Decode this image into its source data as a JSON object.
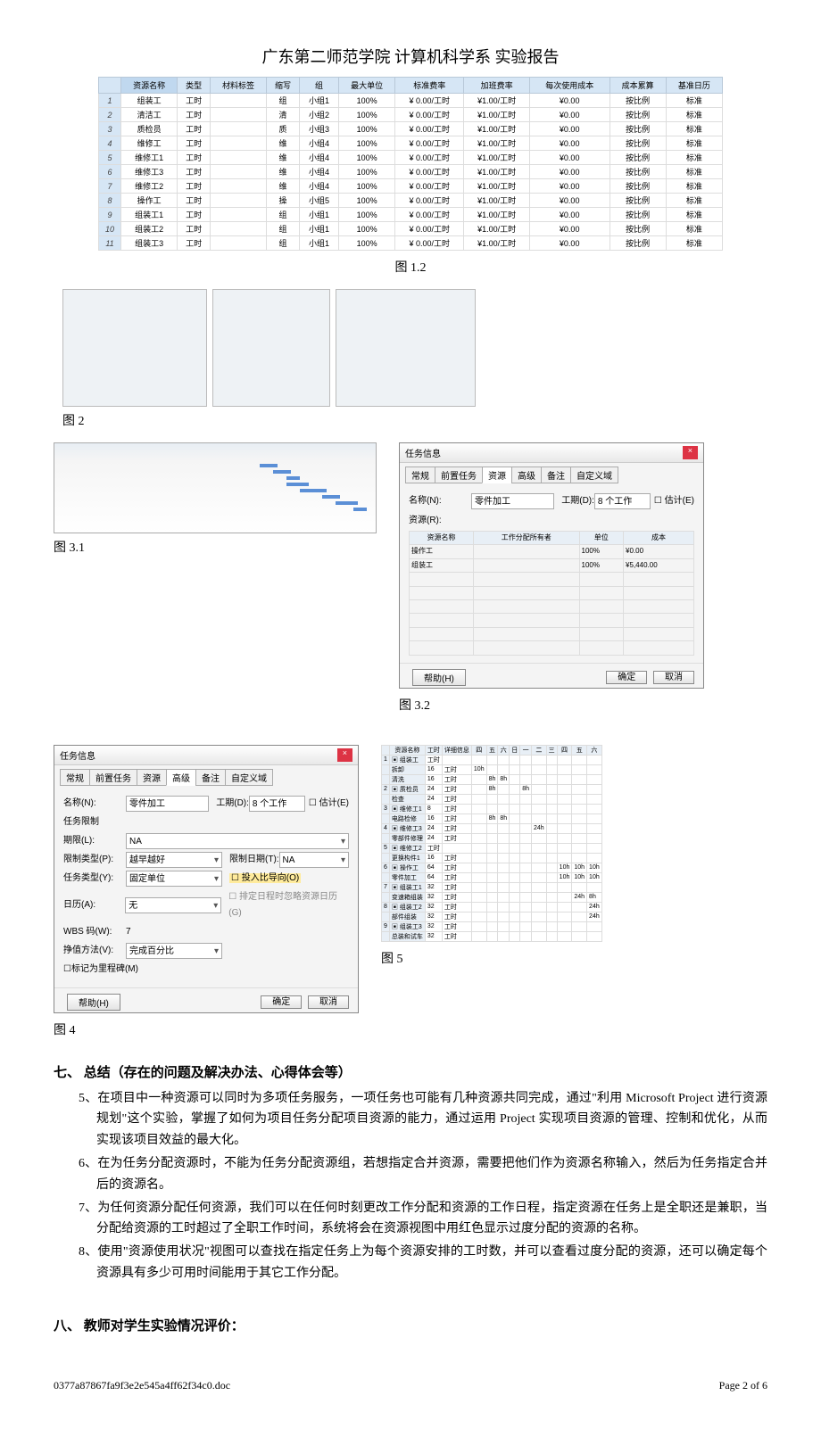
{
  "header": "广东第二师范学院 计算机科学系 实验报告",
  "table1": {
    "headers": [
      "",
      "资源名称",
      "类型",
      "材料标签",
      "缩写",
      "组",
      "最大单位",
      "标准费率",
      "加班费率",
      "每次使用成本",
      "成本累算",
      "基准日历"
    ],
    "rows": [
      [
        "1",
        "组装工",
        "工时",
        "",
        "组",
        "小组1",
        "100%",
        "¥ 0.00/工时",
        "¥1.00/工时",
        "¥0.00",
        "按比例",
        "标准"
      ],
      [
        "2",
        "清洁工",
        "工时",
        "",
        "清",
        "小组2",
        "100%",
        "¥ 0.00/工时",
        "¥1.00/工时",
        "¥0.00",
        "按比例",
        "标准"
      ],
      [
        "3",
        "质检员",
        "工时",
        "",
        "质",
        "小组3",
        "100%",
        "¥ 0.00/工时",
        "¥1.00/工时",
        "¥0.00",
        "按比例",
        "标准"
      ],
      [
        "4",
        "维修工",
        "工时",
        "",
        "维",
        "小组4",
        "100%",
        "¥ 0.00/工时",
        "¥1.00/工时",
        "¥0.00",
        "按比例",
        "标准"
      ],
      [
        "5",
        "维修工1",
        "工时",
        "",
        "维",
        "小组4",
        "100%",
        "¥ 0.00/工时",
        "¥1.00/工时",
        "¥0.00",
        "按比例",
        "标准"
      ],
      [
        "6",
        "维修工3",
        "工时",
        "",
        "维",
        "小组4",
        "100%",
        "¥ 0.00/工时",
        "¥1.00/工时",
        "¥0.00",
        "按比例",
        "标准"
      ],
      [
        "7",
        "维修工2",
        "工时",
        "",
        "维",
        "小组4",
        "100%",
        "¥ 0.00/工时",
        "¥1.00/工时",
        "¥0.00",
        "按比例",
        "标准"
      ],
      [
        "8",
        "操作工",
        "工时",
        "",
        "操",
        "小组5",
        "100%",
        "¥ 0.00/工时",
        "¥1.00/工时",
        "¥0.00",
        "按比例",
        "标准"
      ],
      [
        "9",
        "组装工1",
        "工时",
        "",
        "组",
        "小组1",
        "100%",
        "¥ 0.00/工时",
        "¥1.00/工时",
        "¥0.00",
        "按比例",
        "标准"
      ],
      [
        "10",
        "组装工2",
        "工时",
        "",
        "组",
        "小组1",
        "100%",
        "¥ 0.00/工时",
        "¥1.00/工时",
        "¥0.00",
        "按比例",
        "标准"
      ],
      [
        "11",
        "组装工3",
        "工时",
        "",
        "组",
        "小组1",
        "100%",
        "¥ 0.00/工时",
        "¥1.00/工时",
        "¥0.00",
        "按比例",
        "标准"
      ]
    ]
  },
  "captions": {
    "fig1_2": "图 1.2",
    "fig2": "图 2",
    "fig3_1": "图 3.1",
    "fig3_2": "图 3.2",
    "fig4": "图 4",
    "fig5": "图 5"
  },
  "dialog32": {
    "title": "任务信息",
    "tabs": [
      "常规",
      "前置任务",
      "资源",
      "高级",
      "备注",
      "自定义域"
    ],
    "name_label": "名称(N):",
    "name_value": "零件加工",
    "duration_label": "工期(D):",
    "duration_value": "8 个工作",
    "estimate_label": "估计(E)",
    "res_label": "资源(R):",
    "grid_headers": [
      "资源名称",
      "工作分配所有者",
      "单位",
      "成本"
    ],
    "grid_rows": [
      [
        "操作工",
        "",
        "100%",
        "¥0.00"
      ],
      [
        "组装工",
        "",
        "100%",
        "¥5,440.00"
      ]
    ],
    "help": "帮助(H)",
    "ok": "确定",
    "cancel": "取消"
  },
  "dialog4": {
    "title": "任务信息",
    "tabs": [
      "常规",
      "前置任务",
      "资源",
      "高级",
      "备注",
      "自定义域"
    ],
    "active_tab": "高级",
    "name_label": "名称(N):",
    "name_value": "零件加工",
    "constraint_title": "任务限制",
    "deadline_label": "期限(L):",
    "deadline_value": "NA",
    "constraint_type_label": "限制类型(P):",
    "constraint_type_value": "越早越好",
    "constraint_date_label": "限制日期(T):",
    "constraint_date_value": "NA",
    "task_type_label": "任务类型(Y):",
    "task_type_value": "固定单位",
    "effort_label": "投入比导向(O)",
    "calendar_label": "日历(A):",
    "calendar_value": "无",
    "calendar_note": "排定日程时忽略资源日历(G)",
    "wbs_label": "WBS 码(W):",
    "wbs_value": "7",
    "earned_label": "挣值方法(V):",
    "earned_value": "完成百分比",
    "milestone_label": "标记为里程碑(M)",
    "duration_label": "工期(D):",
    "duration_value": "8 个工作",
    "estimate": "估计(E)",
    "help": "帮助(H)",
    "ok": "确定",
    "cancel": "取消"
  },
  "fig5data": {
    "headers": [
      "",
      "资源名称",
      "工时",
      "详细信息"
    ],
    "days": [
      "四",
      "五",
      "六",
      "日",
      "一",
      "二",
      "三",
      "四",
      "五",
      "六"
    ],
    "rows": [
      [
        "1",
        "▣ 组装工",
        "工时",
        "",
        ""
      ],
      [
        "",
        "拆卸",
        "16",
        "工时",
        "10h"
      ],
      [
        "",
        "清洗",
        "16",
        "工时",
        "",
        "8h",
        "8h"
      ],
      [
        "2",
        "▣ 质检员",
        "24",
        "工时",
        "",
        "8h",
        "",
        "",
        "8h"
      ],
      [
        "",
        "检查",
        "24",
        "工时",
        ""
      ],
      [
        "3",
        "▣ 维修工1",
        "8",
        "工时",
        ""
      ],
      [
        "",
        "电路检修",
        "16",
        "工时",
        "",
        "8h",
        "8h"
      ],
      [
        "4",
        "▣ 维修工3",
        "24",
        "工时",
        "",
        "",
        "",
        "",
        "",
        "24h"
      ],
      [
        "",
        "零部件修理",
        "24",
        "工时",
        ""
      ],
      [
        "5",
        "▣ 维修工2",
        "工时",
        ""
      ],
      [
        "",
        "更换构件1",
        "16",
        "工时",
        ""
      ],
      [
        "6",
        "▣ 操作工",
        "64",
        "工时",
        "",
        "",
        "",
        "",
        "",
        "",
        "",
        "10h",
        "10h",
        "10h"
      ],
      [
        "",
        "零件加工",
        "64",
        "工时",
        "",
        "",
        "",
        "",
        "",
        "",
        "",
        "10h",
        "10h",
        "10h"
      ],
      [
        "7",
        "▣ 组装工1",
        "32",
        "工时",
        ""
      ],
      [
        "",
        "变速箱组装",
        "32",
        "工时",
        "",
        "",
        "",
        "",
        "",
        "",
        "",
        "",
        "24h",
        "8h"
      ],
      [
        "8",
        "▣ 组装工2",
        "32",
        "工时",
        "",
        "",
        "",
        "",
        "",
        "",
        "",
        "",
        "",
        "24h",
        "8h"
      ],
      [
        "",
        "部件组装",
        "32",
        "工时",
        "",
        "",
        "",
        "",
        "",
        "",
        "",
        "",
        "",
        "24h",
        "8h"
      ],
      [
        "9",
        "▣ 组装工3",
        "32",
        "工时",
        ""
      ],
      [
        "",
        "总装和试车",
        "32",
        "工时",
        ""
      ]
    ]
  },
  "section7": {
    "heading": "七、 总结（存在的问题及解决办法、心得体会等）",
    "items": [
      "5、在项目中一种资源可以同时为多项任务服务，一项任务也可能有几种资源共同完成，通过\"利用 Microsoft Project 进行资源规划\"这个实验，掌握了如何为项目任务分配项目资源的能力，通过运用 Project 实现项目资源的管理、控制和优化，从而实现该项目效益的最大化。",
      "6、在为任务分配资源时，不能为任务分配资源组，若想指定合并资源，需要把他们作为资源名称输入，然后为任务指定合并后的资源名。",
      "7、为任何资源分配任何资源，我们可以在任何时刻更改工作分配和资源的工作日程，指定资源在任务上是全职还是兼职，当分配给资源的工时超过了全职工作时间，系统将会在资源视图中用红色显示过度分配的资源的名称。",
      "8、使用\"资源使用状况\"视图可以查找在指定任务上为每个资源安排的工时数，并可以查看过度分配的资源，还可以确定每个资源具有多少可用时间能用于其它工作分配。"
    ]
  },
  "section8": "八、 教师对学生实验情况评价：",
  "footer": {
    "file": "0377a87867fa9f3e2e545a4ff62f34c0.doc",
    "page": "Page 2 of 6"
  }
}
